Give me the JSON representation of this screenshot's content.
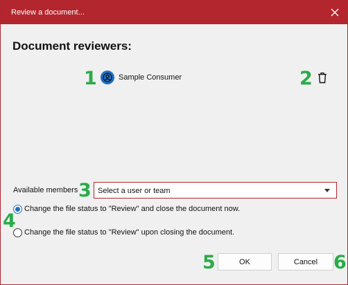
{
  "window": {
    "title": "Review a document..."
  },
  "heading": "Document reviewers:",
  "reviewers": [
    {
      "name": "Sample Consumer"
    }
  ],
  "members": {
    "label": "Available members",
    "select_value": "Select a user or team"
  },
  "options": [
    {
      "label": "Change the file status to \"Review\" and close the document now.",
      "checked": true
    },
    {
      "label": "Change the file status to \"Review\" upon closing the document.",
      "checked": false
    }
  ],
  "buttons": {
    "ok": "OK",
    "cancel": "Cancel"
  },
  "callouts": [
    "1",
    "2",
    "3",
    "4",
    "5",
    "6"
  ],
  "colors": {
    "titlebar": "#b3262d",
    "accent": "#1f6fc4",
    "callout": "#2cab4a"
  },
  "icons": {
    "close": "close-icon",
    "avatar": "user-circle-icon",
    "delete": "trash-icon",
    "dropdown": "chevron-down-icon"
  }
}
